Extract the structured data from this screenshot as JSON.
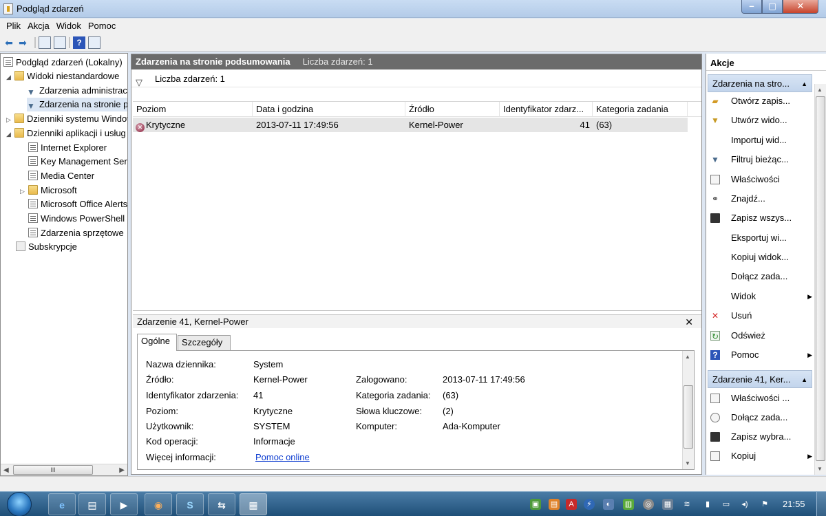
{
  "window": {
    "title": "Podgląd zdarzeń"
  },
  "menu": [
    "Plik",
    "Akcja",
    "Widok",
    "Pomoc"
  ],
  "tree": {
    "items": [
      {
        "label": "Podgląd zdarzeń (Lokalny)",
        "level": 0,
        "arrow": ""
      },
      {
        "label": "Widoki niestandardowe",
        "level": 0,
        "arrow": "◢"
      },
      {
        "label": "Zdarzenia administracyjne",
        "level": 1,
        "arrow": ""
      },
      {
        "label": "Zdarzenia na stronie podsumowania",
        "level": 1,
        "arrow": ""
      },
      {
        "label": "Dzienniki systemu Windows",
        "level": 0,
        "arrow": "▷"
      },
      {
        "label": "Dzienniki aplikacji i usług",
        "level": 0,
        "arrow": "◢"
      },
      {
        "label": "Internet Explorer",
        "level": 1,
        "arrow": ""
      },
      {
        "label": "Key Management Service",
        "level": 1,
        "arrow": ""
      },
      {
        "label": "Media Center",
        "level": 1,
        "arrow": ""
      },
      {
        "label": "Microsoft",
        "level": 1,
        "arrow": "▷"
      },
      {
        "label": "Microsoft Office Alerts",
        "level": 1,
        "arrow": ""
      },
      {
        "label": "Windows PowerShell",
        "level": 1,
        "arrow": ""
      },
      {
        "label": "Zdarzenia sprzętowe",
        "level": 1,
        "arrow": ""
      },
      {
        "label": "Subskrypcje",
        "level": 0,
        "arrow": ""
      }
    ],
    "scroll_glyph": "III"
  },
  "center": {
    "header_title": "Zdarzenia na stronie podsumowania",
    "header_count": "Liczba zdarzeń: 1",
    "filter_text": "Liczba zdarzeń: 1",
    "columns": [
      "Poziom",
      "Data i godzina",
      "Źródło",
      "Identyfikator zdarz...",
      "Kategoria zadania"
    ],
    "row": {
      "level": "Krytyczne",
      "datetime": "2013-07-11 17:49:56",
      "source": "Kernel-Power",
      "id": "41",
      "category": "(63)"
    }
  },
  "detail": {
    "title": "Zdarzenie 41, Kernel-Power",
    "tabs": [
      "Ogólne",
      "Szczegóły"
    ],
    "fields": {
      "log_label": "Nazwa dziennika:",
      "log_value": "System",
      "source_label": "Źródło:",
      "source_value": "Kernel-Power",
      "logged_label": "Zalogowano:",
      "logged_value": "2013-07-11 17:49:56",
      "id_label": "Identyfikator zdarzenia:",
      "id_value": "41",
      "category_label": "Kategoria zadania:",
      "category_value": "(63)",
      "level_label": "Poziom:",
      "level_value": "Krytyczne",
      "keywords_label": "Słowa kluczowe:",
      "keywords_value": "(2)",
      "user_label": "Użytkownik:",
      "user_value": "SYSTEM",
      "computer_label": "Komputer:",
      "computer_value": "Ada-Komputer",
      "opcode_label": "Kod operacji:",
      "opcode_value": "Informacje",
      "more_label": "Więcej informacji:",
      "more_link": "Pomoc online"
    }
  },
  "actions": {
    "title": "Akcje",
    "group1": "Zdarzenia na stro...",
    "group1_items": [
      {
        "label": "Otwórz zapis...",
        "icon": "open-folder-icon",
        "sub": false
      },
      {
        "label": "Utwórz wido...",
        "icon": "filter-icon",
        "sub": false
      },
      {
        "label": "Importuj wid...",
        "icon": "",
        "sub": false
      },
      {
        "label": "Filtruj bieżąc...",
        "icon": "filter-icon",
        "sub": false
      },
      {
        "label": "Właściwości",
        "icon": "properties-icon",
        "sub": false
      },
      {
        "label": "Znajdź...",
        "icon": "binoculars-icon",
        "sub": false
      },
      {
        "label": "Zapisz wszys...",
        "icon": "save-icon",
        "sub": false
      },
      {
        "label": "Eksportuj wi...",
        "icon": "",
        "sub": false
      },
      {
        "label": "Kopiuj widok...",
        "icon": "",
        "sub": false
      },
      {
        "label": "Dołącz zada...",
        "icon": "",
        "sub": false
      },
      {
        "label": "Widok",
        "icon": "",
        "sub": true
      },
      {
        "label": "Usuń",
        "icon": "delete-icon",
        "sub": false
      },
      {
        "label": "Odśwież",
        "icon": "refresh-icon",
        "sub": false
      },
      {
        "label": "Pomoc",
        "icon": "help-icon",
        "sub": true
      }
    ],
    "group2": "Zdarzenie 41, Ker...",
    "group2_items": [
      {
        "label": "Właściwości ...",
        "icon": "properties-icon",
        "sub": false
      },
      {
        "label": "Dołącz zada...",
        "icon": "task-icon",
        "sub": false
      },
      {
        "label": "Zapisz wybra...",
        "icon": "save-icon",
        "sub": false
      },
      {
        "label": "Kopiuj",
        "icon": "copy-icon",
        "sub": true
      }
    ]
  },
  "taskbar": {
    "clock": "21:55"
  }
}
